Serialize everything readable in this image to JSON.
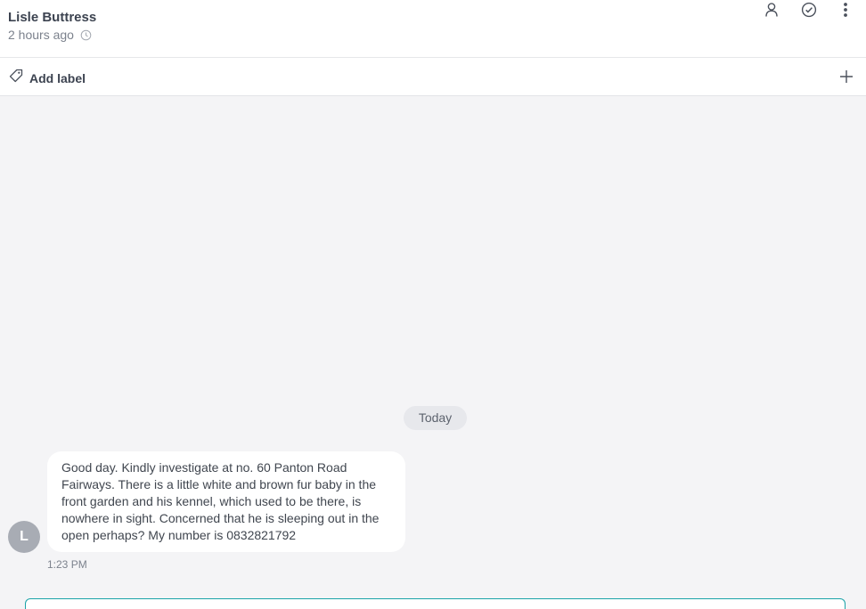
{
  "header": {
    "contact_name": "Lisle Buttress",
    "last_seen": "2 hours ago",
    "icons": [
      "clock-icon",
      "user-icon",
      "check-circle-icon",
      "more-vertical-icon"
    ]
  },
  "labelbar": {
    "add_label": "Add label",
    "icons": [
      "tag-icon",
      "plus-icon"
    ]
  },
  "thread": {
    "date_separator": "Today",
    "messages": [
      {
        "avatar_initial": "L",
        "text": "Good day. Kindly investigate at no. 60 Panton Road Fairways. There is a little white and brown fur baby in the front garden and his kennel, which used to be there, is nowhere in sight. Concerned that he is sleeping out in the open perhaps? My number is 0832821792",
        "time": "1:23 PM"
      }
    ]
  },
  "colors": {
    "accent": "#1aa3a8",
    "background": "#f4f4f6",
    "avatar": "#a8acb4"
  }
}
